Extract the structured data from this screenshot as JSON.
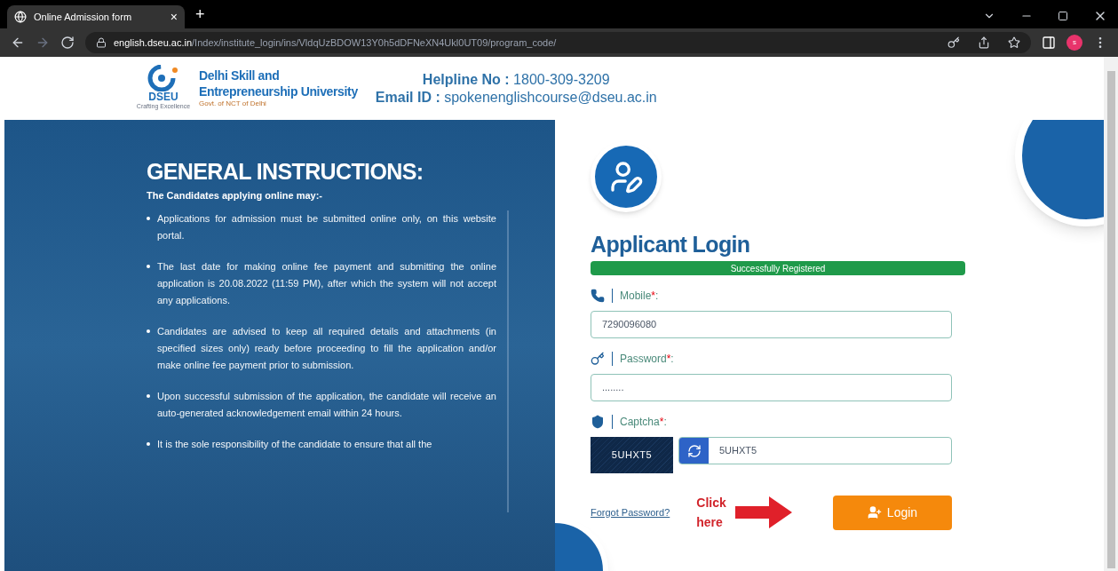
{
  "browser": {
    "tab_title": "Online Admission form",
    "tab_close": "×",
    "new_tab": "+",
    "url_host": "english.dseu.ac.in",
    "url_path": "/Index/institute_login/ins/VldqUzBDOW13Y0h5dDFNeXN4Ukl0UT09/program_code/",
    "profile_initial": "s"
  },
  "header": {
    "logo_text": "DSEU",
    "logo_tagline": "Crafting Excellence",
    "university_line1": "Delhi Skill and",
    "university_line2": "Entrepreneurship University",
    "govt": "Govt. of NCT of Delhi",
    "helpline_label": "Helpline No :",
    "helpline": "1800-309-3209",
    "email_label": "Email ID :",
    "email": "spokenenglishcourse@dseu.ac.in"
  },
  "instructions": {
    "title": "GENERAL INSTRUCTIONS:",
    "subtitle": "The Candidates applying online may:-",
    "items": [
      "Applications for admission must be submitted online only, on this website portal.",
      "The last date for making online fee payment and submitting the online application is 20.08.2022 (11:59 PM), after which the system will not accept any applications.",
      "Candidates are advised to keep all required details and attachments (in specified sizes only) ready before proceeding to fill the application and/or make online fee payment prior to submission.",
      "Upon successful submission of the application, the candidate will receive an auto-generated acknowledgement email within 24 hours.",
      "It is the sole responsibility of the candidate to ensure that all the"
    ]
  },
  "login": {
    "title": "Applicant Login",
    "alert": "Successfully Registered",
    "fields": [
      {
        "kind": "mobile",
        "label": "Mobile",
        "required": "*",
        "separator": ":",
        "value": "7290096080"
      },
      {
        "kind": "password",
        "label": "Password",
        "required": "*",
        "separator": ":",
        "value": "........"
      },
      {
        "kind": "captcha",
        "label": "Captcha",
        "required": "*",
        "separator": ":",
        "captcha_image": "5UHXT5",
        "value": "5UHXT5"
      }
    ],
    "forgot": "Forgot Password?",
    "annotation": "Click here",
    "button": "Login"
  }
}
